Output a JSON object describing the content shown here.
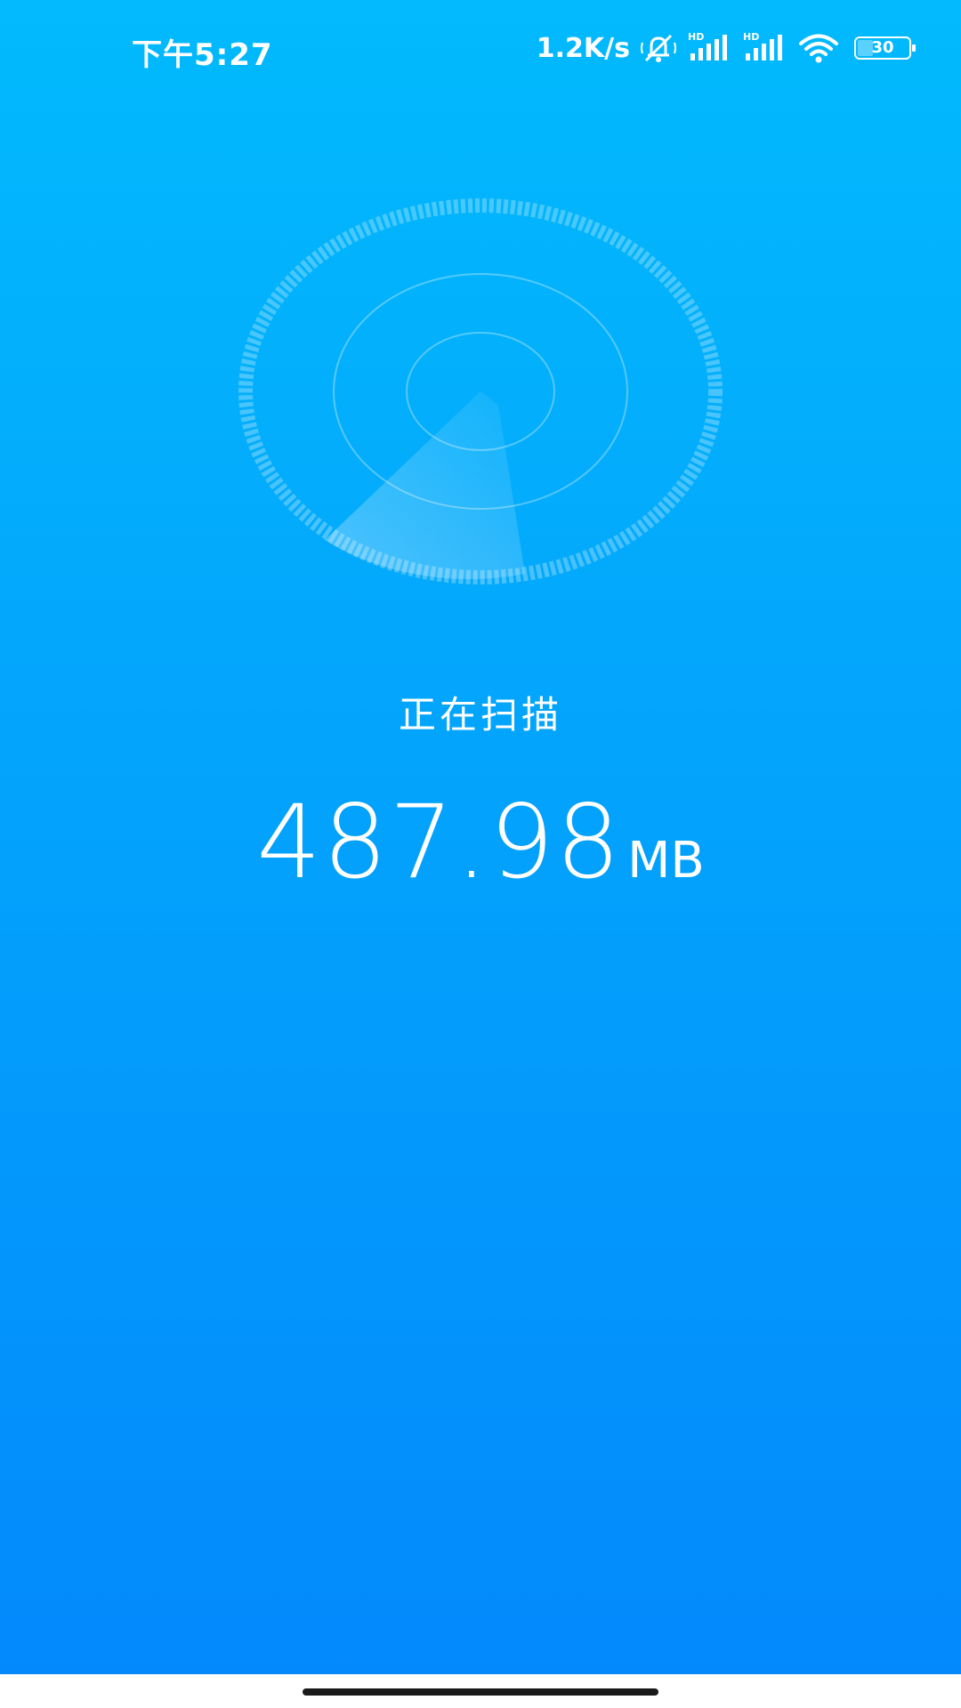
{
  "status_bar": {
    "time": "下午5:27",
    "net_speed": "1.2K/s",
    "icons": [
      "mute-bell-icon",
      "hd-signal-icon",
      "hd-signal-icon",
      "wifi-icon",
      "battery-icon"
    ],
    "battery_level": "30",
    "battery_fraction": 0.3
  },
  "scan": {
    "status_label": "正在扫描",
    "size_value": "487.98",
    "size_unit": "MB"
  },
  "colors": {
    "background_top": "#02bafd",
    "background_bottom": "#0389fc",
    "text": "#ffffff"
  }
}
